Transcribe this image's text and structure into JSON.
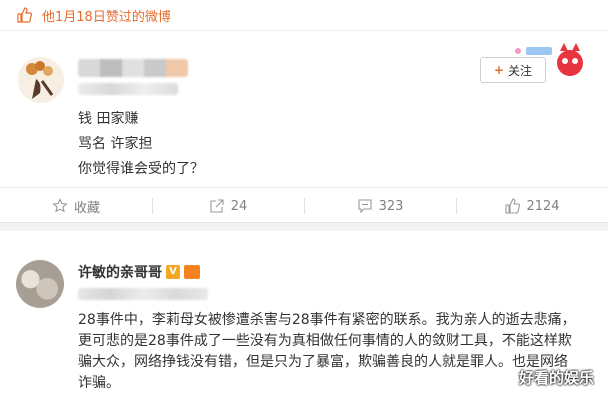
{
  "liked_bar": {
    "text": "他1月18日赞过的微博",
    "accent": "#e86c2f"
  },
  "post1": {
    "follow_label": "关注",
    "lines": [
      "钱 田家赚",
      "骂名 许家担",
      "你觉得谁会受的了？"
    ],
    "actions": [
      {
        "icon": "star-icon",
        "label": "收藏"
      },
      {
        "icon": "share-icon",
        "label": "24"
      },
      {
        "icon": "comment-icon",
        "label": "323"
      },
      {
        "icon": "like-icon",
        "label": "2124"
      }
    ]
  },
  "post2": {
    "author": "许敏的亲哥哥",
    "lines": [
      "28事件中，李莉母女被惨遭杀害与28事件有紧密的联系。我为亲人的逝去悲痛，",
      "更可悲的是28事件成了一些没有为真相做任何事情的人的敛财工具，不能这样欺",
      "骗大众，网络挣钱没有错，但是只为了暴富，欺骗善良的人就是罪人。也是网络",
      "诈骗。"
    ]
  },
  "watermark": "好看的娱乐"
}
